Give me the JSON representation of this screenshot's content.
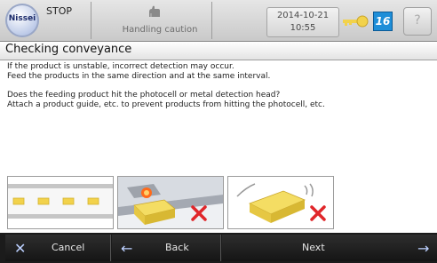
{
  "status": {
    "state": "STOP",
    "message": "Handling caution",
    "date": "2014-10-21",
    "time": "10:55",
    "user_level": "16",
    "help_label": "?"
  },
  "logo": {
    "text": "Nissei"
  },
  "title": "Checking conveyance",
  "body": [
    "If the product is unstable, incorrect detection may occur.",
    "Feed the products in the same direction and at the same interval.",
    "",
    "Does the feeding product hit the photocell or metal detection head?",
    "Attach a product guide, etc. to prevent products from hitting the photocell, etc."
  ],
  "illustrations": [
    {
      "icon": "conveyor-correct-icon"
    },
    {
      "icon": "product-hitting-photocell-icon"
    },
    {
      "icon": "product-unstable-icon"
    }
  ],
  "buttons": {
    "cancel": "Cancel",
    "back": "Back",
    "next": "Next"
  },
  "colors": {
    "accent_blue": "#1e8ed8",
    "cross_red": "#e0262a",
    "product_yellow": "#f2d24b",
    "bottom_bar": "#1b1b1b"
  }
}
